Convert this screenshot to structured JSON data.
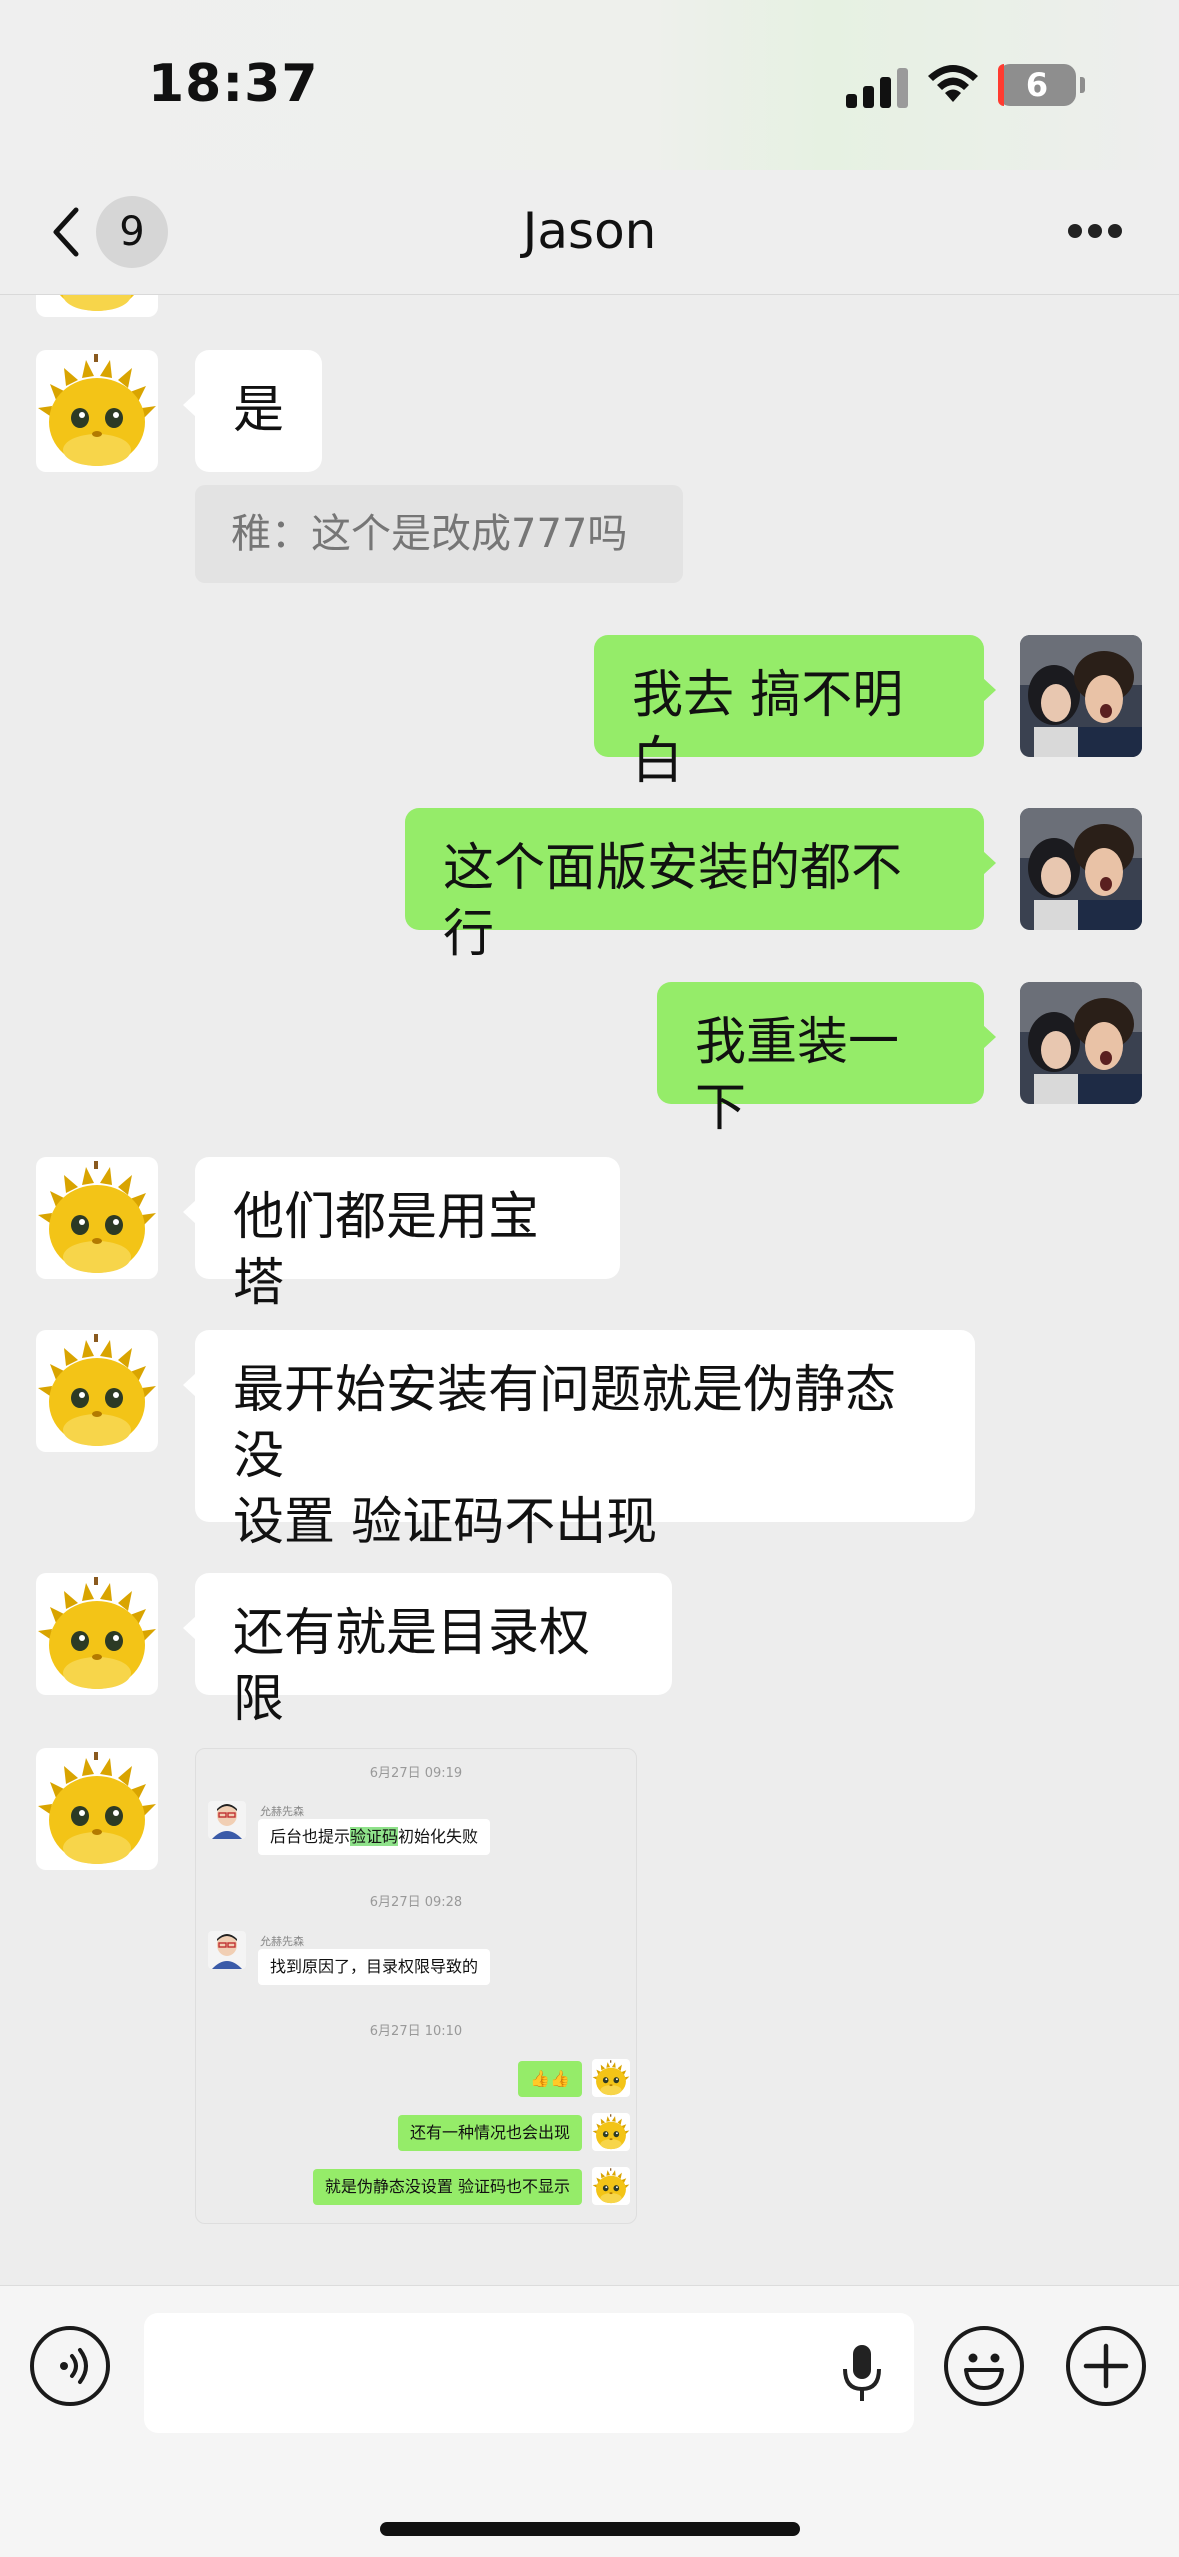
{
  "status_bar": {
    "time": "18:37",
    "battery": "6"
  },
  "nav": {
    "back_count": "9",
    "title": "Jason"
  },
  "messages": [
    {
      "side": "left",
      "text": "是"
    },
    {
      "quote": "稚：这个是改成777吗"
    },
    {
      "side": "right",
      "text": "我去 搞不明白"
    },
    {
      "side": "right",
      "text": "这个面版安装的都不行"
    },
    {
      "side": "right",
      "text": "我重装一下"
    },
    {
      "side": "left",
      "text": "他们都是用宝塔"
    },
    {
      "side": "left",
      "line1": "最开始安装有问题就是伪静态没",
      "line2": "设置 验证码不出现"
    },
    {
      "side": "left",
      "text": "还有就是目录权限"
    }
  ],
  "screenshot": {
    "ts1": "6月27日 09:19",
    "name1": "允赫先森",
    "msg1_pre": "后台也提示",
    "msg1_hl": "验证码",
    "msg1_post": "初始化失败",
    "ts2": "6月27日 09:28",
    "name2": "允赫先森",
    "msg2": "找到原因了，目录权限导致的",
    "ts3": "6月27日 10:10",
    "msg3": "👍👍",
    "msg4": "还有一种情况也会出现",
    "msg5": "就是伪静态没设置 验证码也不显示"
  },
  "icons": [
    "back-chevron-icon",
    "more-icon",
    "voice-icon",
    "microphone-icon",
    "emoji-icon",
    "plus-icon"
  ],
  "colors": {
    "sent_bubble": "#95ec69",
    "received_bubble": "#ffffff",
    "background": "#ededed"
  }
}
